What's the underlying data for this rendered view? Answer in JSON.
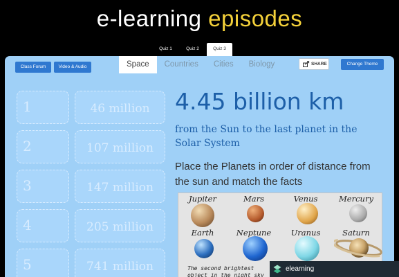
{
  "site_title": {
    "part1": "e-learning",
    "part2": "episodes"
  },
  "quiz_tabs": [
    "Quiz 1",
    "Quiz 2",
    "Quiz 3"
  ],
  "toolbar": {
    "class_forum": "Class Forum",
    "video_audio": "Video & Audio",
    "share": "SHARE",
    "change_theme": "Change Theme"
  },
  "subject_tabs": [
    "Space",
    "Countries",
    "Cities",
    "Biology"
  ],
  "order_slots": [
    "1",
    "2",
    "3",
    "4",
    "5"
  ],
  "distance_values": [
    "46 million",
    "107 million",
    "147 million",
    "205 million",
    "741 million"
  ],
  "fact": {
    "distance": "4.45 billion km",
    "description": "from the Sun to the last planet in the Solar System",
    "instruction": "Place the Planets in order of distance from the sun and match the facts"
  },
  "planets": [
    "Jupiter",
    "Mars",
    "Venus",
    "Mercury",
    "Earth",
    "Neptune",
    "Uranus",
    "Saturn"
  ],
  "fact_card": "The second brightest object in the night sky after the Moon",
  "badge": {
    "label": "elearning",
    "icon": "elearning-logo-icon"
  },
  "colors": {
    "panel": "#9fd0f7",
    "accent": "#2f78d0",
    "title_gold": "#f4d13a",
    "headline": "#1d5fa8"
  }
}
